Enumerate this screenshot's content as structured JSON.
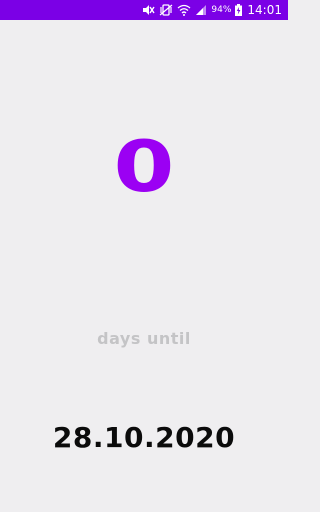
{
  "status_bar": {
    "battery_percent": "94%",
    "time": "14:01",
    "icons": [
      "mute-icon",
      "vibrate-icon",
      "wifi-icon",
      "cell-signal-icon",
      "battery-charging-icon"
    ],
    "background": "#7b00e6"
  },
  "countdown": {
    "value": "0",
    "color": "#9b00f3",
    "label": "days until",
    "label_color": "#c4c4c6",
    "date": "28.10.2020",
    "date_color": "#0b0b0b"
  },
  "background": "#efeef0"
}
